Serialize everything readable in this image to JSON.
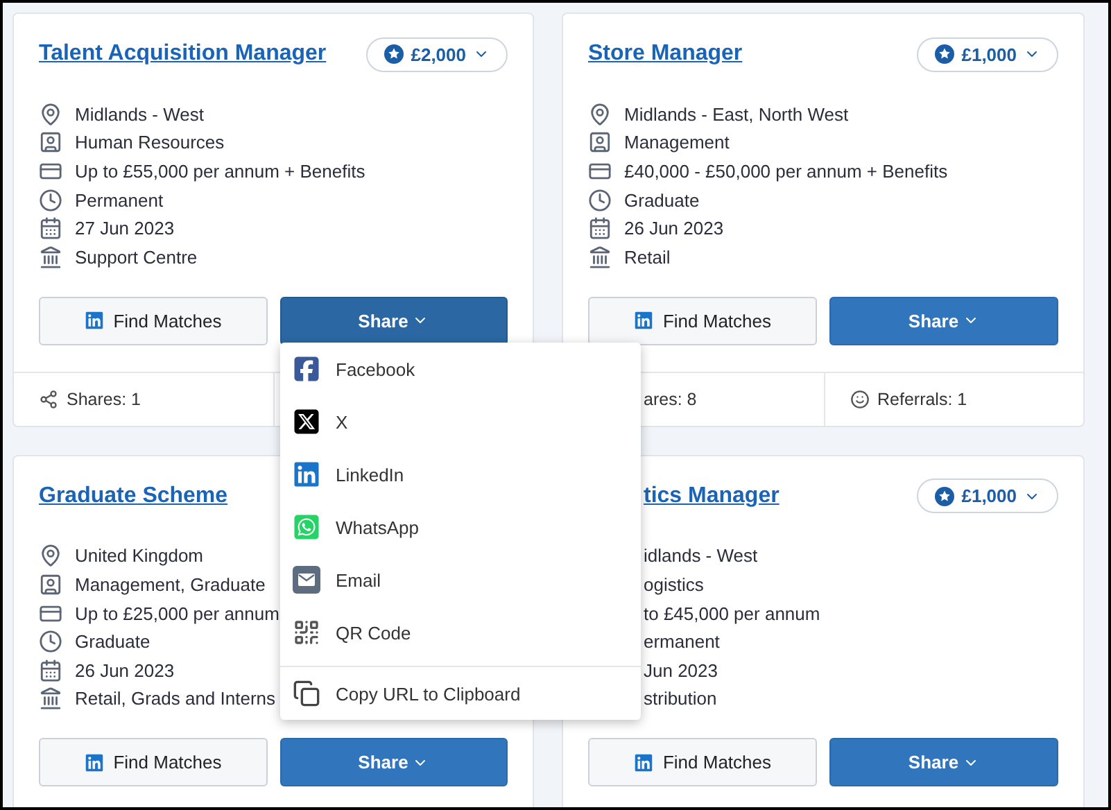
{
  "cards": [
    {
      "title": "Talent Acquisition Manager",
      "reward": "£2,000",
      "details": [
        {
          "kind": "location",
          "text": "Midlands - West"
        },
        {
          "kind": "category",
          "text": "Human Resources"
        },
        {
          "kind": "salary",
          "text": "Up to £55,000 per annum + Benefits"
        },
        {
          "kind": "contract",
          "text": "Permanent"
        },
        {
          "kind": "date",
          "text": "27 Jun 2023"
        },
        {
          "kind": "branch",
          "text": "Support Centre"
        }
      ],
      "find_button": "Find Matches",
      "share_button": {
        "label": "Share",
        "expanded": true
      },
      "footer": [
        {
          "kind": "shares",
          "text": "Shares: 1"
        }
      ]
    },
    {
      "title": "Store Manager",
      "reward": "£1,000",
      "details": [
        {
          "kind": "location",
          "text": "Midlands - East, North West"
        },
        {
          "kind": "category",
          "text": "Management"
        },
        {
          "kind": "salary",
          "text": "£40,000 - £50,000 per annum + Benefits"
        },
        {
          "kind": "contract",
          "text": "Graduate"
        },
        {
          "kind": "date",
          "text": "26 Jun 2023"
        },
        {
          "kind": "branch",
          "text": "Retail"
        }
      ],
      "find_button": "Find Matches",
      "share_button": {
        "label": "Share",
        "expanded": false
      },
      "footer": [
        {
          "text": "ares: 8"
        },
        {
          "kind": "referrals",
          "text": "Referrals: 1"
        }
      ]
    },
    {
      "title": "Graduate Scheme",
      "details": [
        {
          "kind": "location",
          "text": "United Kingdom"
        },
        {
          "kind": "category",
          "text": "Management, Graduate"
        },
        {
          "kind": "salary",
          "text": "Up to £25,000 per annum"
        },
        {
          "kind": "contract",
          "text": "Graduate"
        },
        {
          "kind": "date",
          "text": "26 Jun 2023"
        },
        {
          "kind": "branch",
          "text": "Retail, Grads and Interns"
        }
      ],
      "find_button": "Find Matches",
      "share_button": {
        "label": "Share",
        "expanded": false
      }
    },
    {
      "title": "tics Manager",
      "partly_covered": true,
      "reward": "£1,000",
      "details": [
        {
          "text": "idlands - West"
        },
        {
          "text": "ogistics"
        },
        {
          "text": "to £45,000 per annum"
        },
        {
          "text": "ermanent"
        },
        {
          "text": "Jun 2023"
        },
        {
          "text": "stribution"
        }
      ],
      "find_button": "Find Matches",
      "share_button": {
        "label": "Share",
        "expanded": false
      }
    }
  ],
  "share_menu": {
    "items": [
      {
        "kind": "facebook",
        "label": "Facebook"
      },
      {
        "kind": "x",
        "label": "X"
      },
      {
        "kind": "linkedin",
        "label": "LinkedIn"
      },
      {
        "kind": "whatsapp",
        "label": "WhatsApp"
      },
      {
        "kind": "email",
        "label": "Email"
      },
      {
        "kind": "qr",
        "label": "QR Code"
      },
      {
        "kind": "copy",
        "label": "Copy URL to Clipboard"
      }
    ]
  }
}
